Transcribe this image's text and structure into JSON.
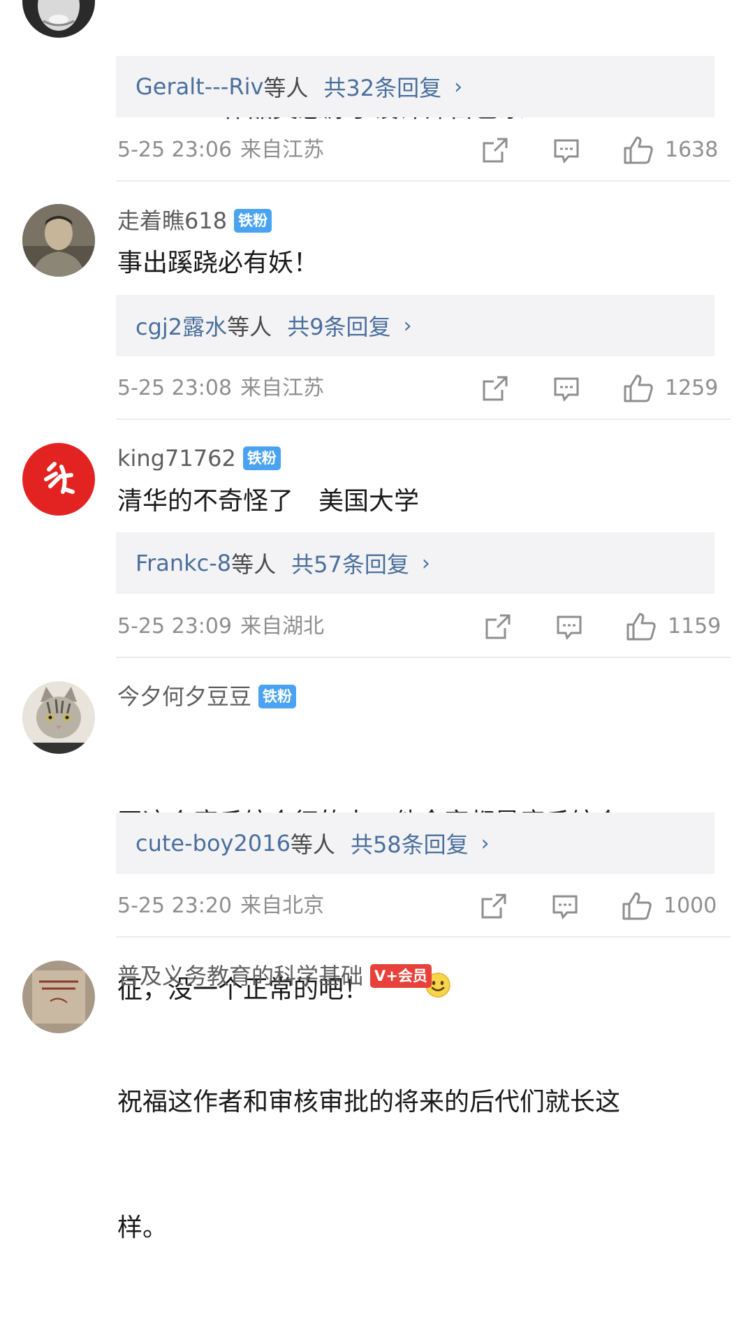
{
  "comments": [
    {
      "username": "",
      "badge": "",
      "text": "作品灵感源于设计师自己家",
      "leading_emoji": "doge-emoji",
      "reply_users": "Geralt---Riv",
      "reply_suffix": "等人",
      "reply_count": "共32条回复",
      "time": "5-25 23:06",
      "region": "来自江苏",
      "likes": "1638"
    },
    {
      "username": "走着瞧618",
      "badge": "铁粉",
      "text": "事出蹊跷必有妖！",
      "reply_users": "cgj2露水",
      "reply_suffix": "等人",
      "reply_count": "共9条回复",
      "time": "5-25 23:08",
      "region": "来自江苏",
      "likes": "1259"
    },
    {
      "username": "king71762",
      "badge": "铁粉",
      "text": "清华的不奇怪了　美国大学",
      "reply_users": "Frankc-8",
      "reply_suffix": "等人",
      "reply_count": "共57条回复",
      "time": "5-25 23:09",
      "region": "来自湖北",
      "likes": "1159"
    },
    {
      "username": "今夕何夕豆豆",
      "badge": "铁粉",
      "text_line1": "画这个唐氏综合征的人，他全家都是唐氏综合",
      "text_line2": "征，没一个正常的吧！",
      "trailing_emoji": "smile-emoji",
      "reply_users": "cute-boy2016",
      "reply_suffix": "等人",
      "reply_count": "共58条回复",
      "time": "5-25 23:20",
      "region": "来自北京",
      "likes": "1000"
    },
    {
      "username": "普及义务教育的科学基础",
      "badge": "V+会员",
      "text_line1": "祝福这作者和审核审批的将来的后代们就长这",
      "text_line2": "样。"
    }
  ],
  "icons": {
    "share": "share-icon",
    "comment": "comment-icon",
    "like": "thumbs-up-icon",
    "chevron": "›"
  },
  "colors": {
    "link": "#4a6f9c",
    "badge_fan": "#4aa3f0",
    "badge_vip": "#e8413b",
    "meta": "#8e8e8e"
  }
}
